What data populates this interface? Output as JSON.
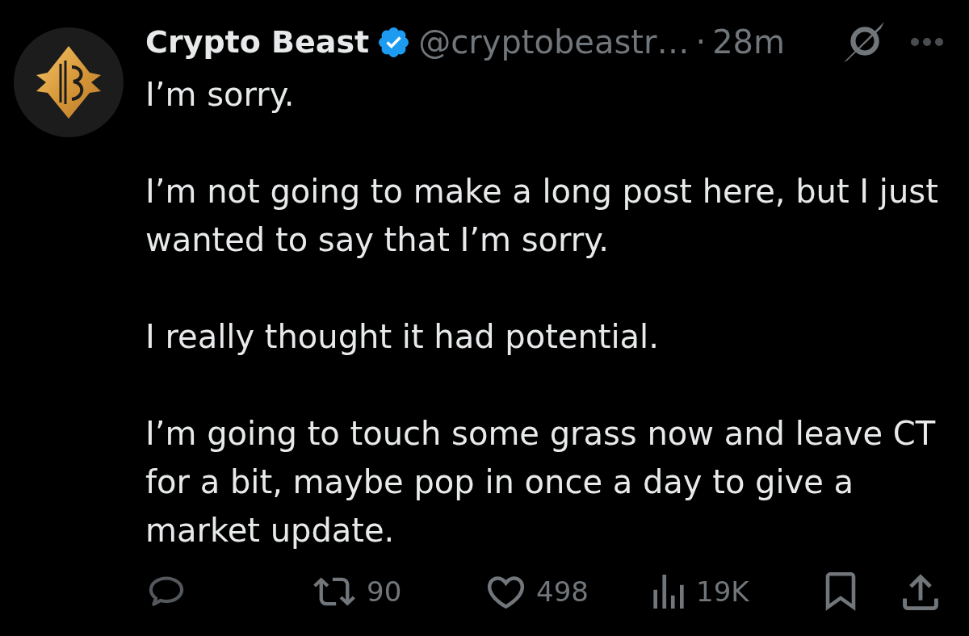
{
  "post": {
    "author": {
      "name": "Crypto Beast",
      "verified": true,
      "handle": "@cryptobeastr…",
      "separator": "·",
      "time": "28m"
    },
    "paragraphs": [
      "I’m sorry.",
      "I’m not going to make a long post here, but I just wanted to say that I’m sorry.",
      "I really thought it had potential.",
      "I’m going to touch some grass now and leave CT for a bit, maybe pop in once a day to give a market update."
    ],
    "actions": [
      {
        "kind": "reply"
      },
      {
        "kind": "repost",
        "count": "90"
      },
      {
        "kind": "like",
        "count": "498"
      },
      {
        "kind": "views",
        "count": "19K"
      },
      {
        "kind": "bookmark"
      },
      {
        "kind": "share"
      }
    ]
  }
}
